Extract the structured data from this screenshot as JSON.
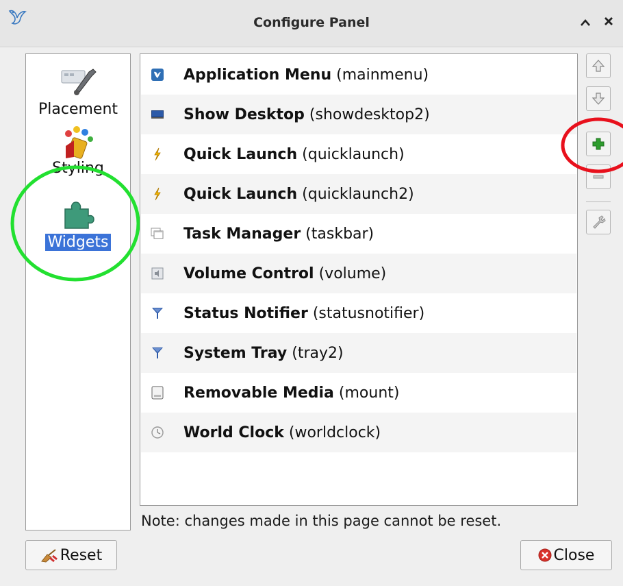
{
  "window": {
    "title": "Configure Panel",
    "collapse_glyph": "^",
    "close_glyph": "✕",
    "logo_icon": "kite-logo-icon"
  },
  "sidebar": {
    "items": [
      {
        "label": "Placement",
        "icon": "placement-wrench-icon",
        "selected": false
      },
      {
        "label": "Styling",
        "icon": "styling-paint-icon",
        "selected": false
      },
      {
        "label": "Widgets",
        "icon": "puzzle-piece-icon",
        "selected": true
      }
    ]
  },
  "widgets": [
    {
      "name": "Application Menu",
      "id": "(mainmenu)",
      "icon": "app-menu-icon"
    },
    {
      "name": "Show Desktop",
      "id": "(showdesktop2)",
      "icon": "desktop-icon"
    },
    {
      "name": "Quick Launch",
      "id": "(quicklaunch)",
      "icon": "lightning-icon"
    },
    {
      "name": "Quick Launch",
      "id": "(quicklaunch2)",
      "icon": "lightning-icon"
    },
    {
      "name": "Task Manager",
      "id": "(taskbar)",
      "icon": "task-windows-icon"
    },
    {
      "name": "Volume Control",
      "id": "(volume)",
      "icon": "volume-icon"
    },
    {
      "name": "Status Notifier",
      "id": "(statusnotifier)",
      "icon": "funnel-icon"
    },
    {
      "name": "System Tray",
      "id": "(tray2)",
      "icon": "funnel-icon"
    },
    {
      "name": "Removable Media",
      "id": "(mount)",
      "icon": "drive-icon"
    },
    {
      "name": "World Clock",
      "id": "(worldclock)",
      "icon": "clock-icon"
    }
  ],
  "toolbar": {
    "buttons": [
      "move-up-icon",
      "move-down-icon",
      "add-icon",
      "remove-icon",
      "configure-icon"
    ]
  },
  "note": "Note: changes made in this page cannot be reset.",
  "buttons": {
    "reset_label": "Reset",
    "close_label": "Close"
  },
  "colors": {
    "selection": "#3b73d8",
    "annotation_green": "#22e030",
    "annotation_red": "#e8101c",
    "add_green": "#2e9d2e"
  }
}
